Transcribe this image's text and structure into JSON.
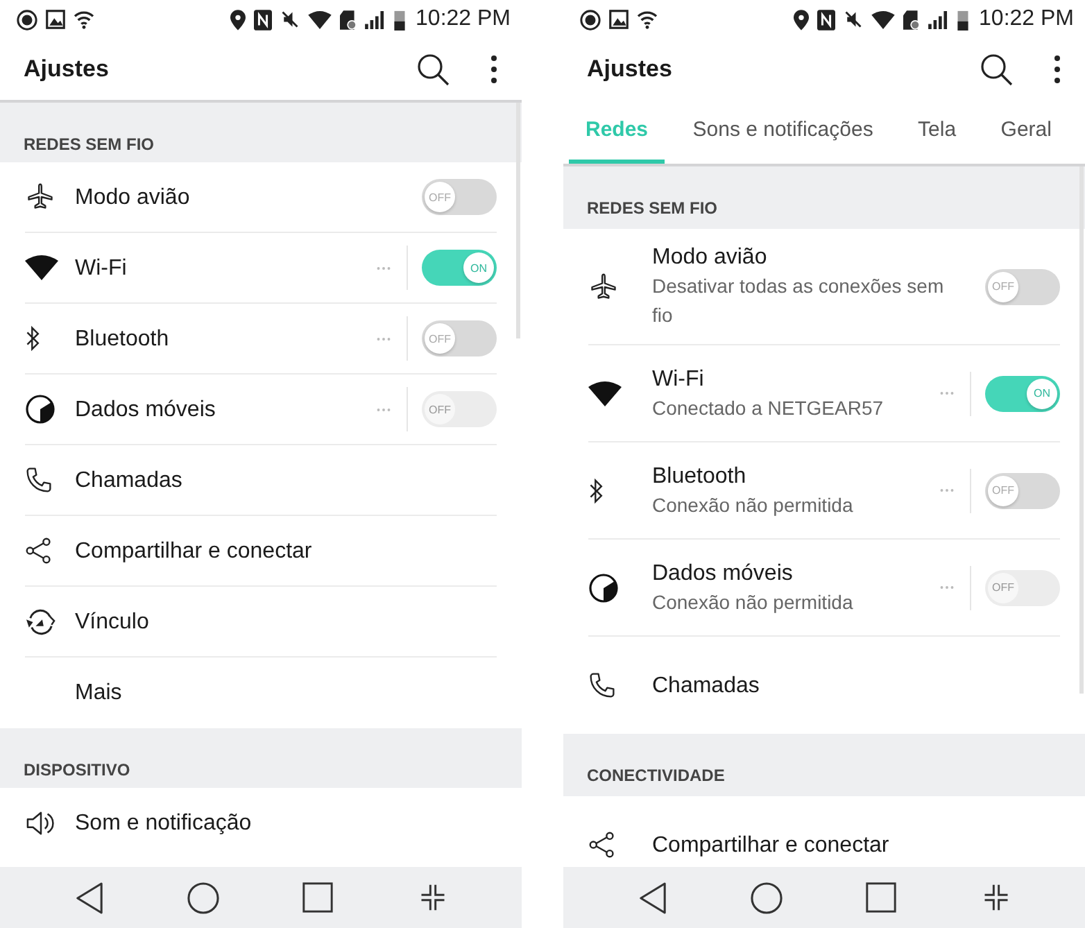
{
  "screens": [
    {
      "status_bar": {
        "time": "10:22 PM"
      },
      "app_bar": {
        "title": "Ajustes"
      },
      "sections": [
        {
          "header": "REDES SEM FIO",
          "items": [
            {
              "kind": "toggle",
              "label": "Modo avião",
              "on": false,
              "disabled": false,
              "more_button": false,
              "switch_label": "OFF"
            },
            {
              "kind": "toggle",
              "label": "Wi-Fi",
              "on": true,
              "disabled": false,
              "more_button": true,
              "switch_label": "ON"
            },
            {
              "kind": "toggle",
              "label": "Bluetooth",
              "on": false,
              "disabled": false,
              "more_button": true,
              "switch_label": "OFF"
            },
            {
              "kind": "toggle",
              "label": "Dados móveis",
              "on": false,
              "disabled": true,
              "more_button": true,
              "switch_label": "OFF"
            },
            {
              "kind": "link",
              "label": "Chamadas"
            },
            {
              "kind": "link",
              "label": "Compartilhar e conectar"
            },
            {
              "kind": "link",
              "label": "Vínculo"
            },
            {
              "kind": "link",
              "label": "Mais"
            }
          ]
        },
        {
          "header": "DISPOSITIVO",
          "items": [
            {
              "kind": "link",
              "label": "Som e notificação"
            }
          ]
        }
      ]
    },
    {
      "status_bar": {
        "time": "10:22 PM"
      },
      "app_bar": {
        "title": "Ajustes"
      },
      "tabs": [
        {
          "label": "Redes",
          "selected": true
        },
        {
          "label": "Sons e notificações",
          "selected": false
        },
        {
          "label": "Tela",
          "selected": false
        },
        {
          "label": "Geral",
          "selected": false
        }
      ],
      "sections": [
        {
          "header": "REDES SEM FIO",
          "items": [
            {
              "kind": "toggle",
              "label": "Modo avião",
              "subtitle": "Desativar todas as conexões sem fio",
              "on": false,
              "disabled": false,
              "more_button": false,
              "switch_label": "OFF"
            },
            {
              "kind": "toggle",
              "label": "Wi-Fi",
              "subtitle": "Conectado a NETGEAR57",
              "on": true,
              "disabled": false,
              "more_button": true,
              "switch_label": "ON"
            },
            {
              "kind": "toggle",
              "label": "Bluetooth",
              "subtitle": "Conexão não permitida",
              "on": false,
              "disabled": false,
              "more_button": true,
              "switch_label": "OFF"
            },
            {
              "kind": "toggle",
              "label": "Dados móveis",
              "subtitle": "Conexão não permitida",
              "on": false,
              "disabled": true,
              "more_button": true,
              "switch_label": "OFF"
            },
            {
              "kind": "link",
              "label": "Chamadas"
            }
          ]
        },
        {
          "header": "CONECTIVIDADE",
          "items": [
            {
              "kind": "link",
              "label": "Compartilhar e conectar"
            }
          ]
        }
      ]
    }
  ]
}
